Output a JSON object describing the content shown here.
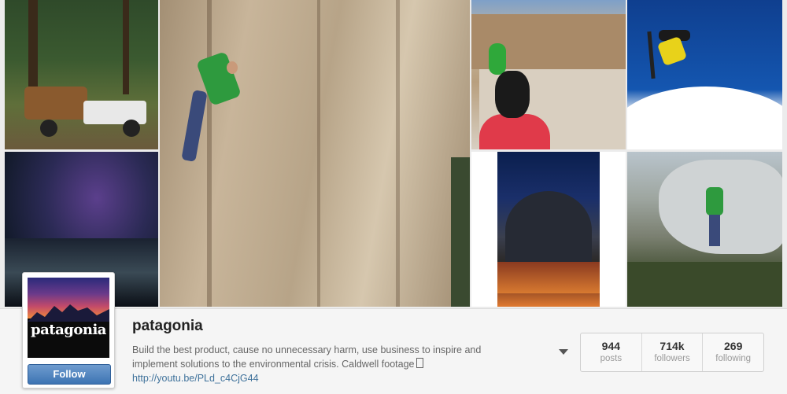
{
  "grid": {
    "photos": [
      {
        "name": "camper-truck-forest-photo"
      },
      {
        "name": "night-sky-waterfall-photo"
      },
      {
        "name": "climber-rock-wall-photo"
      },
      {
        "name": "village-parrot-photo"
      },
      {
        "name": "snowboarder-jump-photo"
      },
      {
        "name": "el-capitan-night-photo"
      },
      {
        "name": "boulder-climber-photo"
      }
    ]
  },
  "profile": {
    "logo_text": "patagonia",
    "follow_label": "Follow",
    "username": "patagonia",
    "bio_line1": "Build the best product, cause no unnecessary harm, use business to inspire and",
    "bio_line2": "implement solutions to the environmental crisis. Caldwell footage",
    "bio_link": "http://youtu.be/PLd_c4CjG44",
    "stats": [
      {
        "value": "944",
        "label": "posts"
      },
      {
        "value": "714k",
        "label": "followers"
      },
      {
        "value": "269",
        "label": "following"
      }
    ]
  },
  "colors": {
    "follow_button": "#3d74b3",
    "link": "#3f729b",
    "background": "#ececec"
  }
}
